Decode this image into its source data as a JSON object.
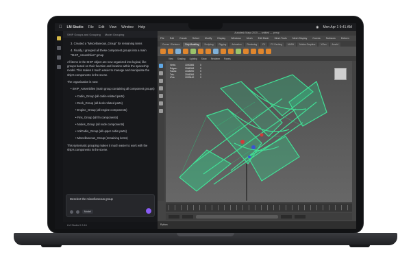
{
  "menubar": {
    "app_name": "LM Studio",
    "items": [
      "File",
      "Edit",
      "View",
      "Window",
      "Help"
    ],
    "clock": "Mon Apr 1  9:41 AM"
  },
  "chat": {
    "tabs": [
      "SHIP Groups and Grouping",
      "Model Grouping"
    ],
    "messages": [
      {
        "text": "3. Created a \"Miscellaneous_Group\" for remaining items",
        "indent": 1
      },
      {
        "text": "4. Finally, I grouped all these component groups into a main \"SHIP_Assemblies\" group",
        "indent": 1
      },
      {
        "text": "All items in the SHIP object are now organized into logical, like groups based on their function and location within the spaceship model. This makes it much easier to manage and manipulate the ship's components in the scene.",
        "indent": 0
      },
      {
        "text": "The organization is now:",
        "indent": 0
      },
      {
        "text": "• SHIP_Assemblies (main group containing all component groups)",
        "indent": 1
      },
      {
        "text": "• Cabin_Group (all cabin-related parts)",
        "indent": 2
      },
      {
        "text": "• Deck_Group (all deck-related parts)",
        "indent": 2
      },
      {
        "text": "• Engine_Group (all engine components)",
        "indent": 2
      },
      {
        "text": "• Fins_Group (all fin components)",
        "indent": 2
      },
      {
        "text": "• Nodes_Group (all node components)",
        "indent": 2
      },
      {
        "text": "• VolCabin_Group (all upper cabin parts)",
        "indent": 2
      },
      {
        "text": "• Miscellaneous_Group (remaining items)",
        "indent": 2
      },
      {
        "text": "This systematic grouping makes it much easier to work with the ship's components in the scene.",
        "indent": 0
      }
    ],
    "composer_text": "Deselect the miscellaneous group",
    "model_label": "Model",
    "status": "LM Studio 0.3.16"
  },
  "maya": {
    "title": "Autodesk Maya 2025 — untitled — persp",
    "menu": [
      "File",
      "Edit",
      "Create",
      "Select",
      "Modify",
      "Display",
      "Windows",
      "Mesh",
      "Edit Mesh",
      "Mesh Tools",
      "Mesh Display",
      "Curves",
      "Surfaces",
      "Deform"
    ],
    "shelf_tabs": [
      "Curves / Surfaces",
      "Poly Modeling",
      "Sculpting",
      "Rigging",
      "Animation",
      "Rendering",
      "FX",
      "FX Caching",
      "MASH",
      "Motion Graphics",
      "XGen",
      "Arnold"
    ],
    "active_shelf_tab": 1,
    "panel_menu": [
      "View",
      "Shading",
      "Lighting",
      "Show",
      "Renderer",
      "Panels"
    ],
    "hud_rows": [
      [
        "Verts:",
        "1000086",
        "0"
      ],
      [
        "Edges:",
        "2086058",
        "0"
      ],
      [
        "Faces:",
        "1048090",
        "0"
      ],
      [
        "Tris:",
        "2006056",
        "0"
      ],
      [
        "UVs:",
        "1099440",
        "0"
      ]
    ],
    "viewport_label": "persp",
    "cmdline": "Python"
  },
  "colors": {
    "wireframe": "#41e89a",
    "accent": "#8a5cf6",
    "maya_orange": "#e0862d"
  }
}
